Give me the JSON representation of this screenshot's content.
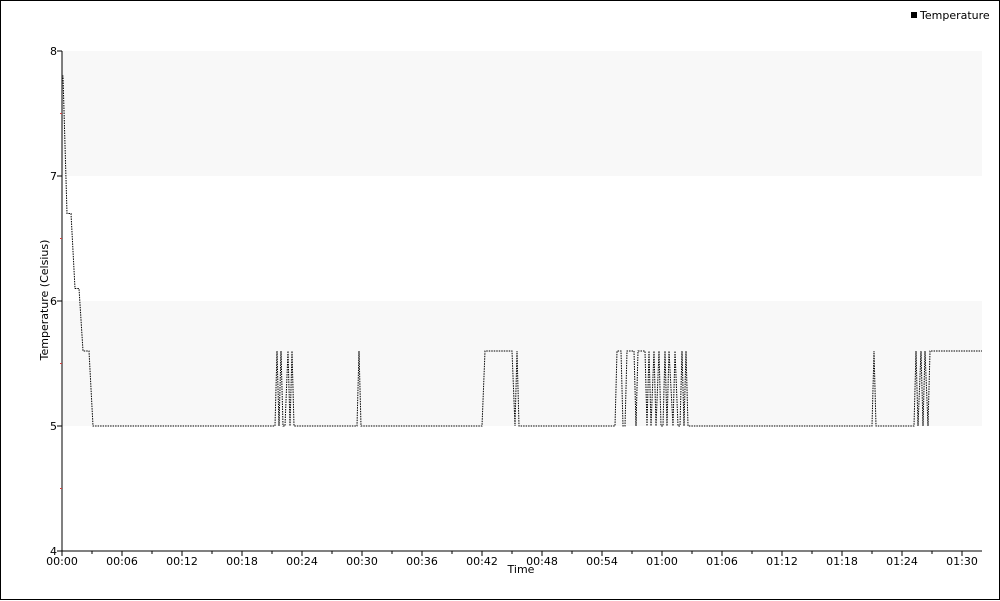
{
  "chart_data": {
    "type": "line",
    "title": "",
    "xlabel": "Time",
    "ylabel": "Temperature (Celsius)",
    "xlim": [
      0,
      92
    ],
    "ylim": [
      4,
      8
    ],
    "x_tick_labels": [
      "00:00",
      "00:06",
      "00:12",
      "00:18",
      "00:24",
      "00:30",
      "00:36",
      "00:42",
      "00:48",
      "00:54",
      "01:00",
      "01:06",
      "01:12",
      "01:18",
      "01:24",
      "01:30"
    ],
    "y_ticks": [
      4,
      5,
      6,
      7,
      8
    ],
    "bands": [
      [
        5,
        6
      ],
      [
        7,
        8
      ]
    ],
    "band_color": "#f8f8f8",
    "line_color": "#000000",
    "legend": {
      "position": "top-right",
      "items": [
        "Temperature"
      ]
    },
    "series": [
      {
        "name": "Temperature",
        "x": [
          0.0,
          0.1,
          0.5,
          0.9,
          1.3,
          1.7,
          2.1,
          2.7,
          3.1,
          21.3,
          21.5,
          21.7,
          21.9,
          22.1,
          22.3,
          22.6,
          22.8,
          23.0,
          23.2,
          29.5,
          29.7,
          29.9,
          42.0,
          42.3,
          45.0,
          45.3,
          45.5,
          45.7,
          55.3,
          55.5,
          55.9,
          56.1,
          56.3,
          56.5,
          57.2,
          57.4,
          57.6,
          58.3,
          58.5,
          58.7,
          58.9,
          59.2,
          59.4,
          59.7,
          59.9,
          60.1,
          60.3,
          60.5,
          60.7,
          61.1,
          61.3,
          61.6,
          61.8,
          62.0,
          62.2,
          62.4,
          62.6,
          81.0,
          81.2,
          81.4,
          85.2,
          85.4,
          85.6,
          85.9,
          86.1,
          86.3,
          86.6,
          86.8,
          92.0
        ],
        "y": [
          7.8,
          7.8,
          6.7,
          6.7,
          6.1,
          6.1,
          5.6,
          5.6,
          5.0,
          5.0,
          5.6,
          5.0,
          5.6,
          5.0,
          5.0,
          5.6,
          5.0,
          5.6,
          5.0,
          5.0,
          5.6,
          5.0,
          5.0,
          5.6,
          5.6,
          5.0,
          5.6,
          5.0,
          5.0,
          5.6,
          5.6,
          5.0,
          5.0,
          5.6,
          5.6,
          5.0,
          5.6,
          5.6,
          5.0,
          5.6,
          5.0,
          5.6,
          5.0,
          5.6,
          5.0,
          5.0,
          5.6,
          5.0,
          5.6,
          5.0,
          5.6,
          5.0,
          5.0,
          5.6,
          5.0,
          5.6,
          5.0,
          5.0,
          5.6,
          5.0,
          5.0,
          5.6,
          5.0,
          5.6,
          5.0,
          5.6,
          5.0,
          5.6,
          5.6
        ]
      }
    ]
  }
}
